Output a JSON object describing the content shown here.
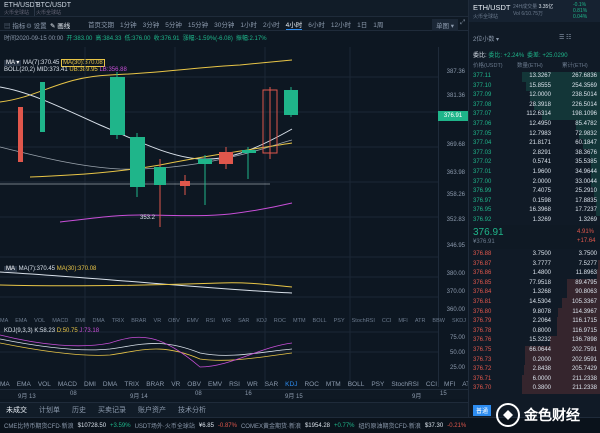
{
  "header": {
    "tabs": [
      {
        "name": "ETH/USDT",
        "sub": "火币全球站"
      },
      {
        "name": "BTC/USDT",
        "sub": "火币全球站"
      }
    ],
    "tools": [
      "指标",
      "设置",
      "画线"
    ],
    "periods": [
      "首页交期",
      "1分",
      "1分钟",
      "3分钟",
      "5分钟",
      "15分钟",
      "30分钟",
      "1小时",
      "2小时",
      "4小时",
      "6小时",
      "12小时",
      "1日",
      "1周"
    ],
    "active_period": "4小时",
    "right_buttons": [
      "单图"
    ]
  },
  "chart": {
    "info_line": [
      "时间2020-09-15 00:00",
      "开:383.00",
      "高:384.33",
      "低:376.00",
      "收:376.91",
      "涨幅:-1.59%(-6.08)",
      "振幅:2.17%"
    ],
    "ma_line": [
      "MA(7):370.45",
      "MA(30):370.08"
    ],
    "boll_line": [
      "BOLL(20,2)",
      "MID:373.41",
      "UB:389.95",
      "LB:356.88"
    ],
    "y_ticks": [
      "387.36",
      "381.36",
      "376.91",
      "369.68",
      "363.98",
      "358.26",
      "352.83",
      "346.95",
      "380.00",
      "370.00",
      "360.00",
      "75.00",
      "50.00",
      "25.00"
    ],
    "current_price": "376.91",
    "low_marker": "353.2",
    "sub1_label": [
      "MA",
      "MA(7):370.45",
      "MA(30):370.08"
    ],
    "sub2_label": [
      "KDJ(9,3,3)",
      "K:58.23",
      "D:50.75",
      "J:73.18"
    ],
    "indicators_small": [
      "MA",
      "EMA",
      "VOL",
      "MACD",
      "DMI",
      "DMA",
      "TRIX",
      "BRAR",
      "VR",
      "OBV",
      "EMV",
      "RSI",
      "WR",
      "SAR",
      "KDJ",
      "ROC",
      "MTM",
      "BOLL",
      "PSY",
      "StochRSI",
      "CCI",
      "MFI",
      "ATR",
      "BBW",
      "SKDJ"
    ],
    "indicators_large": [
      "MA",
      "EMA",
      "VOL",
      "MACD",
      "DMI",
      "DMA",
      "TRIX",
      "BRAR",
      "VR",
      "OBV",
      "EMV",
      "RSI",
      "WR",
      "SAR",
      "KDJ",
      "ROC",
      "MTM",
      "BOLL",
      "PSY",
      "StochRSI",
      "CCI",
      "MFI",
      "ATR"
    ],
    "active_indicator": "KDJ",
    "dates": [
      "9月 13",
      "08",
      "9月 14",
      "08",
      "16",
      "9月 15",
      "9月",
      "15"
    ]
  },
  "bottom_tabs": [
    "未成交",
    "计划单",
    "历史",
    "买卖记录",
    "账户资产",
    "技术分析"
  ],
  "ticker": [
    {
      "label": "CME比特币期货CFD·新浪",
      "value": "$10728.50",
      "change": "+3.59%",
      "dir": "up"
    },
    {
      "label": "USDT场外·火币全球站",
      "value": "¥6.85",
      "change": "-0.87%",
      "dir": "down"
    },
    {
      "label": "COMEX黄金期货·新浪",
      "value": "$1954.28",
      "change": "+0.77%",
      "dir": "up"
    },
    {
      "label": "纽约原油期货CFD·新浪",
      "value": "$37.30",
      "change": "-0.21%",
      "dir": "down"
    }
  ],
  "right_panel": {
    "pair": "ETH/USDT",
    "exchange": "火币全球站",
    "stats": [
      {
        "label": "24H成交量",
        "value": "3.35亿"
      },
      {
        "label": "5m涨幅",
        "value": "-0.1%"
      },
      {
        "label": "24h成交额",
        "value": "0.81%"
      }
    ],
    "stats_right": [
      "-0.1%",
      "0.81%",
      "0.04%"
    ],
    "vol_label": "Vol 6/10.75万",
    "depth_label": "2位小数",
    "cmp_left": "委比: +2.24%",
    "cmp_right": "委差: +25.0290",
    "col_price": "价格(USDT)",
    "col_qty": "数量(ETH)",
    "col_total": "累计(ETH)",
    "bids": [
      {
        "p": "377.11",
        "q": "13.3267",
        "t": "267.6836"
      },
      {
        "p": "377.10",
        "q": "15.8555",
        "t": "254.3569"
      },
      {
        "p": "377.09",
        "q": "12.0000",
        "t": "238.5014"
      },
      {
        "p": "377.08",
        "q": "28.3918",
        "t": "226.5014"
      },
      {
        "p": "377.07",
        "q": "112.6314",
        "t": "198.1096"
      },
      {
        "p": "377.06",
        "q": "12.4950",
        "t": "85.4782"
      },
      {
        "p": "377.05",
        "q": "12.7983",
        "t": "72.9832"
      },
      {
        "p": "377.04",
        "q": "21.8171",
        "t": "60.1847"
      },
      {
        "p": "377.03",
        "q": "2.8291",
        "t": "38.3676"
      },
      {
        "p": "377.02",
        "q": "0.5741",
        "t": "35.5385"
      },
      {
        "p": "377.01",
        "q": "1.9600",
        "t": "34.9644"
      },
      {
        "p": "377.00",
        "q": "2.0000",
        "t": "33.0044"
      },
      {
        "p": "376.99",
        "q": "7.4075",
        "t": "25.2910"
      },
      {
        "p": "376.97",
        "q": "0.1598",
        "t": "17.8835"
      },
      {
        "p": "376.95",
        "q": "16.3968",
        "t": "17.7237"
      },
      {
        "p": "376.92",
        "q": "1.3269",
        "t": "1.3269"
      }
    ],
    "last_price": "376.91",
    "last_price_cny": "¥376.91",
    "last_change_pct": "4.91%",
    "last_change_abs": "+17.64",
    "asks": [
      {
        "p": "376.88",
        "q": "3.7500",
        "t": "3.7500"
      },
      {
        "p": "376.87",
        "q": "3.7777",
        "t": "7.5277"
      },
      {
        "p": "376.86",
        "q": "1.4800",
        "t": "11.8963"
      },
      {
        "p": "376.85",
        "q": "77.9518",
        "t": "89.4795"
      },
      {
        "p": "376.84",
        "q": "1.3268",
        "t": "90.8063"
      },
      {
        "p": "376.81",
        "q": "14.5304",
        "t": "105.3367"
      },
      {
        "p": "376.80",
        "q": "9.8078",
        "t": "114.3967"
      },
      {
        "p": "376.79",
        "q": "2.2064",
        "t": "116.1715"
      },
      {
        "p": "376.78",
        "q": "0.8000",
        "t": "116.9715"
      },
      {
        "p": "376.76",
        "q": "15.3232",
        "t": "136.7898"
      },
      {
        "p": "376.75",
        "q": "66.0644",
        "t": "202.7591"
      },
      {
        "p": "376.73",
        "q": "0.2000",
        "t": "202.9591"
      },
      {
        "p": "376.72",
        "q": "2.8438",
        "t": "205.7429"
      },
      {
        "p": "376.71",
        "q": "6.0000",
        "t": "211.2338"
      },
      {
        "p": "376.70",
        "q": "0.3800",
        "t": "211.2338"
      }
    ],
    "footer_tab": "普通",
    "logo_text": "金色财经"
  },
  "colors": {
    "up": "#1fb58a",
    "down": "#e0574c",
    "accent": "#2d8cf0",
    "bg": "#0d1722"
  }
}
